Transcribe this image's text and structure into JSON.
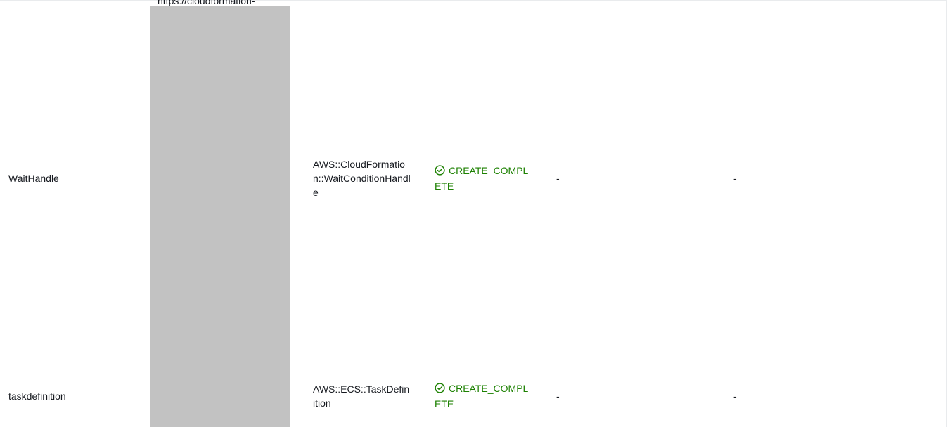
{
  "resources_table": {
    "physical_id_url_fragment": "https://cloudformation-",
    "rows": [
      {
        "logical_id": "WaitHandle",
        "type": "AWS::CloudFormation::WaitConditionHandle",
        "status": "CREATE_COMPLETE",
        "status_reason": "-",
        "module": "-"
      },
      {
        "logical_id": "taskdefinition",
        "type": "AWS::ECS::TaskDefinition",
        "status": "CREATE_COMPLETE",
        "status_reason": "-",
        "module": "-"
      }
    ]
  },
  "colors": {
    "status_complete": "#1d8102",
    "redaction": "#c2c2c2",
    "divider": "#eaeded"
  },
  "icons": {
    "status_icon": "check-circle-icon"
  }
}
